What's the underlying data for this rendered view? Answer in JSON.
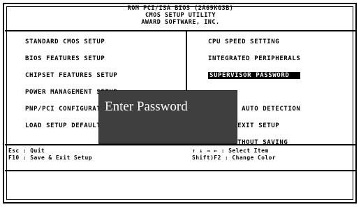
{
  "header": {
    "line1": "ROM PCI/ISA BIOS (2A69KG3B)",
    "line2": "CMOS SETUP UTILITY",
    "line3": "AWARD SOFTWARE, INC."
  },
  "menu_left": [
    {
      "label": "STANDARD CMOS SETUP"
    },
    {
      "label": "BIOS FEATURES SETUP"
    },
    {
      "label": "CHIPSET FEATURES SETUP"
    },
    {
      "label": "POWER MANAGEMENT SETUP"
    },
    {
      "label": "PNP/PCI CONFIGURATION"
    },
    {
      "label": "LOAD SETUP DEFAULTS"
    }
  ],
  "menu_right": [
    {
      "label": "CPU SPEED SETTING",
      "selected": false
    },
    {
      "label": "INTEGRATED PERIPHERALS",
      "selected": false
    },
    {
      "label": "SUPERVISOR PASSWORD",
      "selected": true
    },
    {
      "label": "",
      "selected": false
    },
    {
      "label": "IDE HDD AUTO DETECTION",
      "selected": false
    },
    {
      "label": "SAVE & EXIT SETUP",
      "selected": false
    },
    {
      "label": "EXIT WITHOUT SAVING",
      "selected": false
    }
  ],
  "legend": {
    "left_line1": "Esc : Quit",
    "left_line2": "F10 : Save & Exit Setup",
    "right_line1": "↑ ↓ → ←   : Select Item",
    "right_line2": "Shift)F2 : Change Color"
  },
  "dialog": {
    "label": "Enter Password"
  }
}
